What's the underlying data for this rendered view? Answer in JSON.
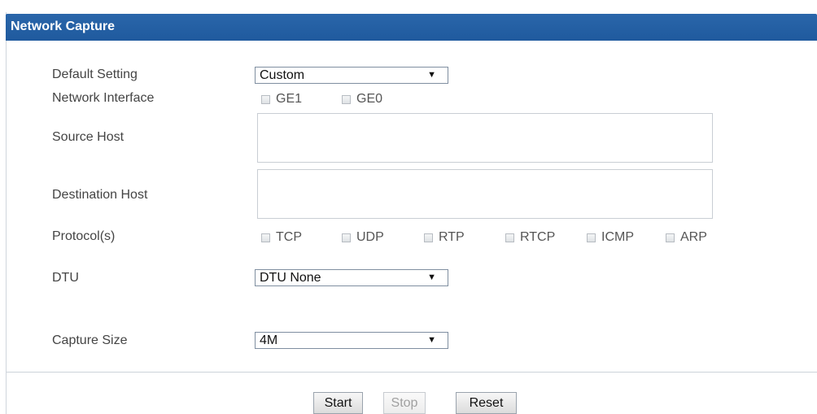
{
  "header": {
    "title": "Network Capture"
  },
  "form": {
    "default_setting": {
      "label": "Default Setting",
      "value": "Custom"
    },
    "network_interface": {
      "label": "Network Interface",
      "options": [
        "GE1",
        "GE0"
      ]
    },
    "source_host": {
      "label": "Source Host",
      "value": ""
    },
    "destination_host": {
      "label": "Destination Host",
      "value": ""
    },
    "protocols": {
      "label": "Protocol(s)",
      "options": [
        "TCP",
        "UDP",
        "RTP",
        "RTCP",
        "ICMP",
        "ARP"
      ]
    },
    "dtu": {
      "label": "DTU",
      "value": "DTU None"
    },
    "capture_size": {
      "label": "Capture Size",
      "value": "4M"
    }
  },
  "buttons": {
    "start": "Start",
    "stop": "Stop",
    "reset": "Reset"
  }
}
